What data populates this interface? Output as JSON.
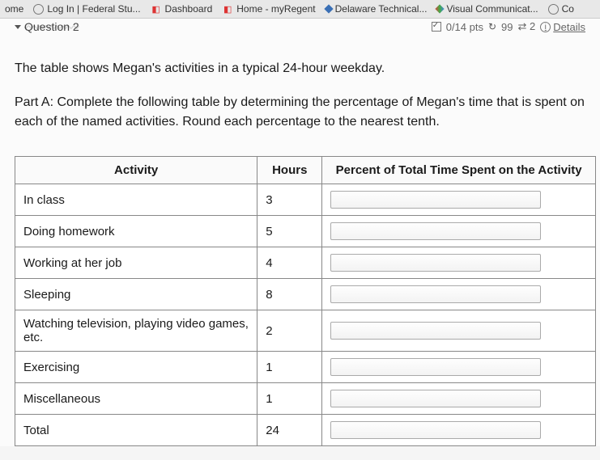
{
  "bookmarks": {
    "items": [
      {
        "label": "ome"
      },
      {
        "label": "Log In | Federal Stu..."
      },
      {
        "label": "Dashboard"
      },
      {
        "label": "Home - myRegent"
      },
      {
        "label": "Delaware Technical..."
      },
      {
        "label": "Visual Communicat..."
      },
      {
        "label": "Co"
      }
    ]
  },
  "question": {
    "label": "Question 2",
    "points": "0/14 pts",
    "attempts": "99",
    "tries": "2",
    "details": "Details"
  },
  "intro": "The table shows Megan's activities in a typical 24-hour weekday.",
  "partA": "Part A: Complete the following table by determining the percentage of Megan's time that is spent on each of the named activities. Round each percentage to the nearest tenth.",
  "table": {
    "headers": {
      "activity": "Activity",
      "hours": "Hours",
      "percent": "Percent of Total Time Spent on the Activity"
    },
    "rows": [
      {
        "activity": "In class",
        "hours": "3"
      },
      {
        "activity": "Doing homework",
        "hours": "5"
      },
      {
        "activity": "Working at her job",
        "hours": "4"
      },
      {
        "activity": "Sleeping",
        "hours": "8"
      },
      {
        "activity": "Watching television, playing video games, etc.",
        "hours": "2"
      },
      {
        "activity": "Exercising",
        "hours": "1"
      },
      {
        "activity": "Miscellaneous",
        "hours": "1"
      },
      {
        "activity": "Total",
        "hours": "24"
      }
    ]
  }
}
